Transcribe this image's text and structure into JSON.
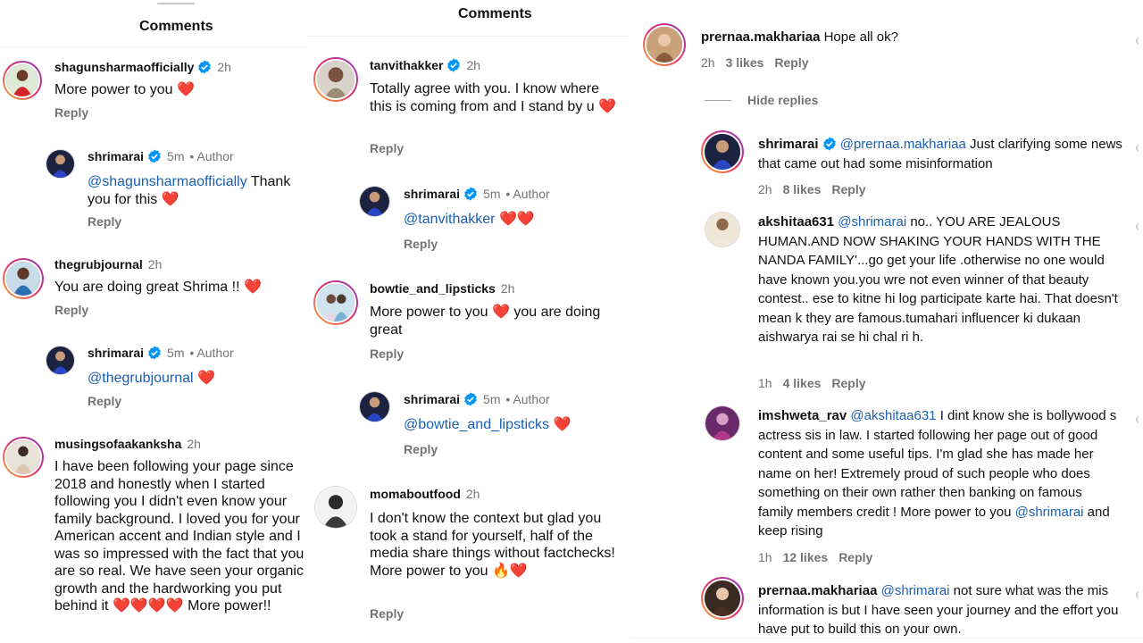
{
  "panel1": {
    "title": "Comments",
    "comments": [
      {
        "user": "shagunsharmaofficially",
        "time": "2h",
        "text": "More power to you",
        "emoji": "❤️",
        "reply": "Reply"
      },
      {
        "user": "shrimarai",
        "time": "5m",
        "author": "• Author",
        "mention": "@shagunsharmaofficially",
        "text": " Thank you for this",
        "emoji": "❤️",
        "reply": "Reply"
      },
      {
        "user": "thegrubjournal",
        "time": "2h",
        "text": "You are doing great Shrima !!",
        "emoji": "❤️",
        "reply": "Reply"
      },
      {
        "user": "shrimarai",
        "time": "5m",
        "author": "• Author",
        "mention": "@thegrubjournal",
        "text": "",
        "emoji": "❤️",
        "reply": "Reply"
      },
      {
        "user": "musingsofaakanksha",
        "time": "2h",
        "text": "I have been following your page since 2018 and honestly when I started following you I didn't even know your family background. I loved you for your American accent and Indian style and I was so impressed with the fact that you are so real. We have seen your organic growth and the hardworking you put behind it",
        "emoji": "❤️❤️❤️❤️",
        "text2": " More power!!"
      }
    ]
  },
  "panel2": {
    "title": "Comments",
    "comments": [
      {
        "user": "tanvithakker",
        "time": "2h",
        "text": "Totally agree with you. I know where this is coming from and I stand by u",
        "emoji": "❤️",
        "reply": "Reply"
      },
      {
        "user": "shrimarai",
        "time": "5m",
        "author": "• Author",
        "mention": "@tanvithakker",
        "emoji": "❤️❤️",
        "reply": "Reply"
      },
      {
        "user": "bowtie_and_lipsticks",
        "time": "2h",
        "text": "More power to you",
        "emoji": "❤️",
        "text2": " you are doing great",
        "reply": "Reply"
      },
      {
        "user": "shrimarai",
        "time": "5m",
        "author": "• Author",
        "mention": "@bowtie_and_lipsticks",
        "emoji": "❤️",
        "reply": "Reply"
      },
      {
        "user": "momaboutfood",
        "time": "2h",
        "text": "I don't know the context but glad you took a stand for yourself, half of the media share things without factchecks!",
        "text2": "More power to you",
        "emoji": "🔥❤️",
        "reply": "Reply"
      }
    ]
  },
  "panel3": {
    "comments": [
      {
        "user": "prernaa.makhariaa",
        "text": "Hope all ok?",
        "time": "2h",
        "likes": "3 likes",
        "reply": "Reply"
      },
      {
        "user": "shrimarai",
        "mention": "@prernaa.makhariaa",
        "text": " Just clarifying some news that came out had some misinformation",
        "time": "2h",
        "likes": "8 likes",
        "reply": "Reply"
      },
      {
        "user": "akshitaa631",
        "mention": "@shrimarai",
        "text": " no.. YOU ARE JEALOUS HUMAN.AND NOW SHAKING YOUR HANDS WITH THE NANDA FAMILY'...go get your life .otherwise no one would have known you.you wre not even winner of that beauty contest.. ese to kitne hi log participate karte hai. That doesn't mean k they are famous.tumahari influencer ki dukaan aishwarya rai se hi chal ri h.",
        "time": "1h",
        "likes": "4 likes",
        "reply": "Reply"
      },
      {
        "user": "imshweta_rav",
        "mention": "@akshitaa631",
        "text": " I dint know she is bollywood s actress sis in law. I started following her page out of good content and some useful tips. I'm glad she has made her name on her! Extremely proud of such people who does something on their own rather then banking on famous family members credit ! More power to you ",
        "mention2": "@shrimarai",
        "text2": " and keep rising",
        "time": "1h",
        "likes": "12 likes",
        "reply": "Reply"
      },
      {
        "user": "prernaa.makhariaa",
        "mention": "@shrimarai",
        "text": " not sure what was the mis information is but I have seen your journey and the effort you have put to build this on your own."
      }
    ],
    "hide_replies": "Hide replies"
  },
  "colors": {
    "verified": "#0095f6",
    "heart": "#e0242c",
    "mention": "#1a5fb4",
    "meta": "#737373",
    "ring_start": "#f9b233",
    "ring_end": "#8a3ab9"
  },
  "icons": {
    "verified": "verified-badge-icon",
    "heart": "heart-emoji",
    "fire": "fire-emoji"
  }
}
